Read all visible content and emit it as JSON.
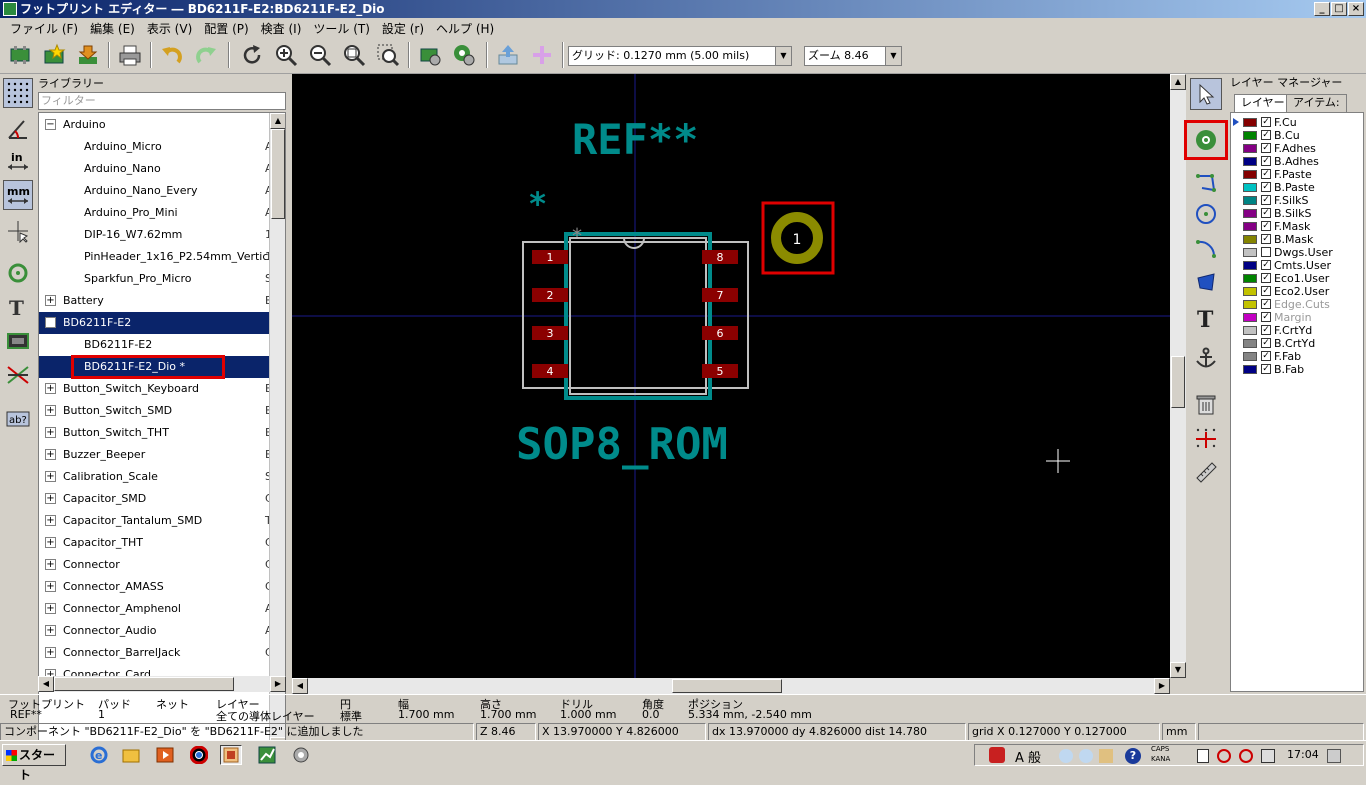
{
  "window": {
    "title": "フットプリント エディター ― BD6211F-E2:BD6211F-E2_Dio",
    "min": "_",
    "max": "□",
    "close": "×"
  },
  "menu": [
    "ファイル (F)",
    "編集 (E)",
    "表示 (V)",
    "配置 (P)",
    "検査 (I)",
    "ツール (T)",
    "設定 (r)",
    "ヘルプ (H)"
  ],
  "toolbar": {
    "grid_value": "グリッド: 0.1270 mm (5.00 mils)",
    "zoom_value": "ズーム 8.46"
  },
  "library": {
    "title": "ライブラリー",
    "filter_placeholder": "フィルター",
    "rows": [
      {
        "label": "Arduino",
        "expand": "−",
        "extra": ""
      },
      {
        "label": "Arduino_Micro",
        "child": true,
        "extra": "A"
      },
      {
        "label": "Arduino_Nano",
        "child": true,
        "extra": "A"
      },
      {
        "label": "Arduino_Nano_Every",
        "child": true,
        "extra": "A"
      },
      {
        "label": "Arduino_Pro_Mini",
        "child": true,
        "extra": "A"
      },
      {
        "label": "DIP-16_W7.62mm",
        "child": true,
        "extra": "1"
      },
      {
        "label": "PinHeader_1x16_P2.54mm_Vertical",
        "child": true,
        "extra": "1"
      },
      {
        "label": "Sparkfun_Pro_Micro",
        "child": true,
        "extra": "S"
      },
      {
        "label": "Battery",
        "expand": "+",
        "extra": "B"
      },
      {
        "label": "BD6211F-E2",
        "expand": "−",
        "extra": "",
        "selected": true
      },
      {
        "label": "BD6211F-E2",
        "child": true,
        "extra": ""
      },
      {
        "label": "BD6211F-E2_Dio *",
        "child": true,
        "extra": "",
        "selected": true,
        "highlight": true
      },
      {
        "label": "Button_Switch_Keyboard",
        "expand": "+",
        "extra": "B"
      },
      {
        "label": "Button_Switch_SMD",
        "expand": "+",
        "extra": "B"
      },
      {
        "label": "Button_Switch_THT",
        "expand": "+",
        "extra": "B"
      },
      {
        "label": "Buzzer_Beeper",
        "expand": "+",
        "extra": "B"
      },
      {
        "label": "Calibration_Scale",
        "expand": "+",
        "extra": "S"
      },
      {
        "label": "Capacitor_SMD",
        "expand": "+",
        "extra": "C"
      },
      {
        "label": "Capacitor_Tantalum_SMD",
        "expand": "+",
        "extra": "T"
      },
      {
        "label": "Capacitor_THT",
        "expand": "+",
        "extra": "C"
      },
      {
        "label": "Connector",
        "expand": "+",
        "extra": "C"
      },
      {
        "label": "Connector_AMASS",
        "expand": "+",
        "extra": "C"
      },
      {
        "label": "Connector_Amphenol",
        "expand": "+",
        "extra": "A"
      },
      {
        "label": "Connector_Audio",
        "expand": "+",
        "extra": "A"
      },
      {
        "label": "Connector_BarrelJack",
        "expand": "+",
        "extra": "C"
      },
      {
        "label": "Connector_Card",
        "expand": "+",
        "extra": ""
      }
    ]
  },
  "canvas": {
    "ref_text": "REF**",
    "value_text": "SOP8_ROM",
    "anchor_mark": "*",
    "pad_left": [
      "1",
      "2",
      "3",
      "4"
    ],
    "pad_right": [
      "8",
      "7",
      "6",
      "5"
    ],
    "new_pad": "1",
    "colors": {
      "background": "#000000",
      "silk": "#008b8b",
      "pad": "#8b0000",
      "new_pad_ring": "#8b8b00"
    }
  },
  "layers": {
    "title": "レイヤー マネージャー",
    "tab_layers": "レイヤー",
    "tab_items": "アイテム:",
    "items": [
      {
        "name": "F.Cu",
        "color": "#840000",
        "checked": true,
        "active": true
      },
      {
        "name": "B.Cu",
        "color": "#008400",
        "checked": true
      },
      {
        "name": "F.Adhes",
        "color": "#840084",
        "checked": true
      },
      {
        "name": "B.Adhes",
        "color": "#000084",
        "checked": true
      },
      {
        "name": "F.Paste",
        "color": "#840000",
        "checked": true
      },
      {
        "name": "B.Paste",
        "color": "#00c2c2",
        "checked": true
      },
      {
        "name": "F.SilkS",
        "color": "#008484",
        "checked": true
      },
      {
        "name": "B.SilkS",
        "color": "#840084",
        "checked": true
      },
      {
        "name": "F.Mask",
        "color": "#840084",
        "checked": true
      },
      {
        "name": "B.Mask",
        "color": "#848400",
        "checked": true
      },
      {
        "name": "Dwgs.User",
        "color": "#c2c2c2",
        "checked": false
      },
      {
        "name": "Cmts.User",
        "color": "#000084",
        "checked": true
      },
      {
        "name": "Eco1.User",
        "color": "#008400",
        "checked": true
      },
      {
        "name": "Eco2.User",
        "color": "#c2c200",
        "checked": true
      },
      {
        "name": "Edge.Cuts",
        "color": "#c2c200",
        "checked": true,
        "dim": true
      },
      {
        "name": "Margin",
        "color": "#c200c2",
        "checked": true,
        "dim": true
      },
      {
        "name": "F.CrtYd",
        "color": "#c2c2c2",
        "checked": true
      },
      {
        "name": "B.CrtYd",
        "color": "#848484",
        "checked": true
      },
      {
        "name": "F.Fab",
        "color": "#848484",
        "checked": true
      },
      {
        "name": "B.Fab",
        "color": "#000084",
        "checked": true
      }
    ]
  },
  "status": {
    "h_footprint": "フットプリント",
    "v_footprint": "REF**",
    "h_pad": "パッド",
    "v_pad": "1",
    "h_net": "ネット",
    "v_net": "",
    "h_layer": "レイヤー",
    "v_layer": "全ての導体レイヤー",
    "h_circle": "円",
    "v_circle": "標準",
    "h_width": "幅",
    "v_width": "1.700 mm",
    "h_height": "高さ",
    "v_height": "1.700 mm",
    "h_drill": "ドリル",
    "v_drill": "1.000 mm",
    "h_angle": "角度",
    "v_angle": "0.0",
    "h_position": "ポジション",
    "v_position": "5.334 mm, -2.540 mm",
    "message": "コンポーネント \"BD6211F-E2_Dio\" を \"BD6211F-E2\" に追加しました",
    "zoom": "Z 8.46",
    "xy": "X 13.970000  Y 4.826000",
    "dxdy": "dx 13.970000  dy 4.826000  dist 14.780",
    "grid": "grid X 0.127000  Y 0.127000",
    "units": "mm"
  },
  "taskbar": {
    "start": "スタート",
    "ime": "A 般",
    "caps": "CAPS",
    "kana": "KANA",
    "clock": "17:04"
  }
}
